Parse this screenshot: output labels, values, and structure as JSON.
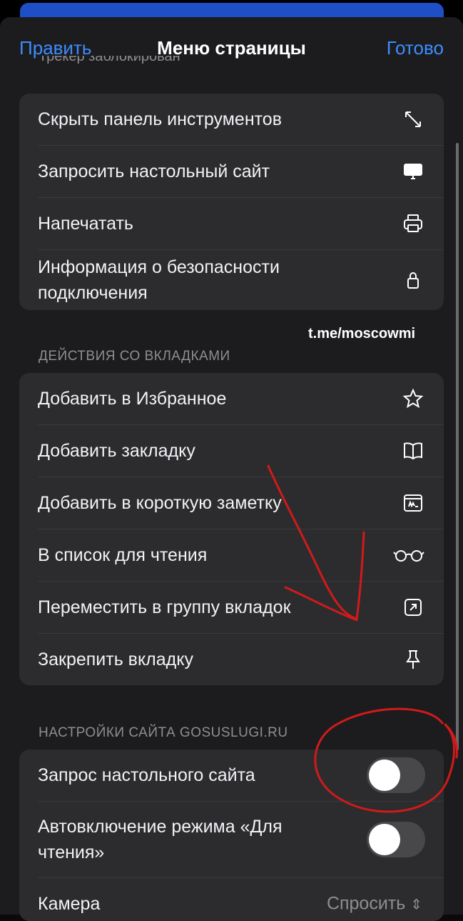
{
  "header": {
    "edit_label": "Править",
    "title": "Меню страницы",
    "done_label": "Готово"
  },
  "cut_text": "Трекер заблокирован",
  "group1": [
    {
      "label": "Скрыть панель инструментов",
      "icon": "resize-diagonal-icon"
    },
    {
      "label": "Запросить настольный сайт",
      "icon": "desktop-icon"
    },
    {
      "label": "Напечатать",
      "icon": "printer-icon"
    },
    {
      "label": "Информация о безопасности подключения",
      "icon": "lock-icon"
    }
  ],
  "watermark": "t.me/moscowmi",
  "tab_actions": {
    "header": "ДЕЙСТВИЯ СО ВКЛАДКАМИ",
    "items": [
      {
        "label": "Добавить в Избранное",
        "icon": "star-icon"
      },
      {
        "label": "Добавить закладку",
        "icon": "book-icon"
      },
      {
        "label": "Добавить в короткую заметку",
        "icon": "quick-note-icon"
      },
      {
        "label": "В список для чтения",
        "icon": "glasses-icon"
      },
      {
        "label": "Переместить в группу вкладок",
        "icon": "move-to-group-icon"
      },
      {
        "label": "Закрепить вкладку",
        "icon": "pin-icon"
      }
    ]
  },
  "site_settings": {
    "header": "НАСТРОЙКИ САЙТА GOSUSLUGI.RU",
    "items": [
      {
        "label": "Запрос настольного сайта",
        "toggle": false
      },
      {
        "label": "Автовключение режима «Для чтения»",
        "toggle": false
      },
      {
        "label": "Камера",
        "value": "Спросить"
      }
    ]
  },
  "colors": {
    "accent": "#3c8dff",
    "annotation": "#d11a1a"
  }
}
